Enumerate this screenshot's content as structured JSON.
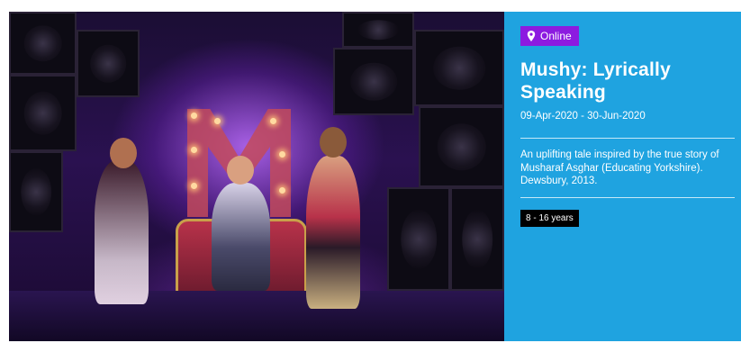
{
  "event": {
    "location": "Online",
    "title": "Mushy: Lyrically Speaking",
    "dates": "09-Apr-2020 - 30-Jun-2020",
    "description": "An uplifting tale inspired by the true story of Musharaf Asghar (Educating Yorkshire). Dewsbury, 2013.",
    "age_range": "8 - 16 years"
  },
  "image": {
    "subject": "stage-performance-photo"
  },
  "colors": {
    "panel_bg": "#1fa3e0",
    "location_badge_bg": "#8c1be0",
    "age_badge_bg": "#000000",
    "text": "#ffffff"
  },
  "icons": {
    "location": "map-pin-icon"
  }
}
